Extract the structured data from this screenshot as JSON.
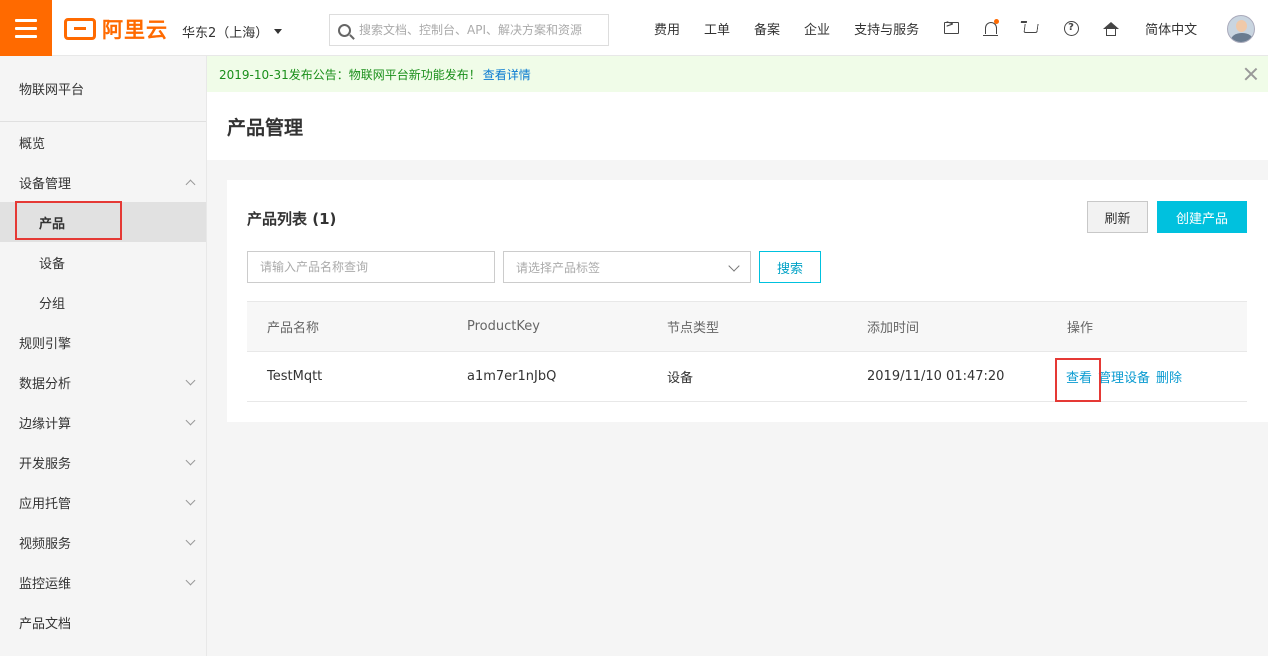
{
  "brand": {
    "logo_text": "阿里云"
  },
  "header": {
    "region": "华东2（上海）",
    "search_placeholder": "搜索文档、控制台、API、解决方案和资源",
    "nav": [
      "费用",
      "工单",
      "备案",
      "企业",
      "支持与服务"
    ],
    "icons": [
      "terminal-icon",
      "bell-icon",
      "cart-icon",
      "help-icon",
      "home-icon"
    ],
    "language": "简体中文"
  },
  "sidebar": {
    "title": "物联网平台",
    "items": [
      {
        "label": "概览",
        "level": 1
      },
      {
        "label": "设备管理",
        "level": 1,
        "expanded": true
      },
      {
        "label": "产品",
        "level": 2,
        "active": true
      },
      {
        "label": "设备",
        "level": 2
      },
      {
        "label": "分组",
        "level": 2
      },
      {
        "label": "规则引擎",
        "level": 1
      },
      {
        "label": "数据分析",
        "level": 1
      },
      {
        "label": "边缘计算",
        "level": 1
      },
      {
        "label": "开发服务",
        "level": 1
      },
      {
        "label": "应用托管",
        "level": 1
      },
      {
        "label": "视频服务",
        "level": 1
      },
      {
        "label": "监控运维",
        "level": 1
      },
      {
        "label": "产品文档",
        "level": 1
      }
    ]
  },
  "notice": {
    "text": "2019-10-31发布公告：物联网平台新功能发布！",
    "link": "查看详情"
  },
  "page": {
    "title": "产品管理",
    "list_title": "产品列表 (1)",
    "refresh_label": "刷新",
    "create_label": "创建产品",
    "name_placeholder": "请输入产品名称查询",
    "tag_placeholder": "请选择产品标签",
    "search_label": "搜索",
    "table": {
      "headers": [
        "产品名称",
        "ProductKey",
        "节点类型",
        "添加时间",
        "操作"
      ],
      "rows": [
        {
          "name": "TestMqtt",
          "product_key": "a1m7er1nJbQ",
          "node_type": "设备",
          "created": "2019/11/10 01:47:20",
          "actions": [
            "查看",
            "管理设备",
            "删除"
          ]
        }
      ]
    }
  },
  "colors": {
    "brand_orange": "#ff6a00",
    "accent_cyan": "#00c1de",
    "link_blue": "#0a9bd1",
    "notice_green": "#1a8f1a",
    "highlight_red": "#e53935"
  }
}
